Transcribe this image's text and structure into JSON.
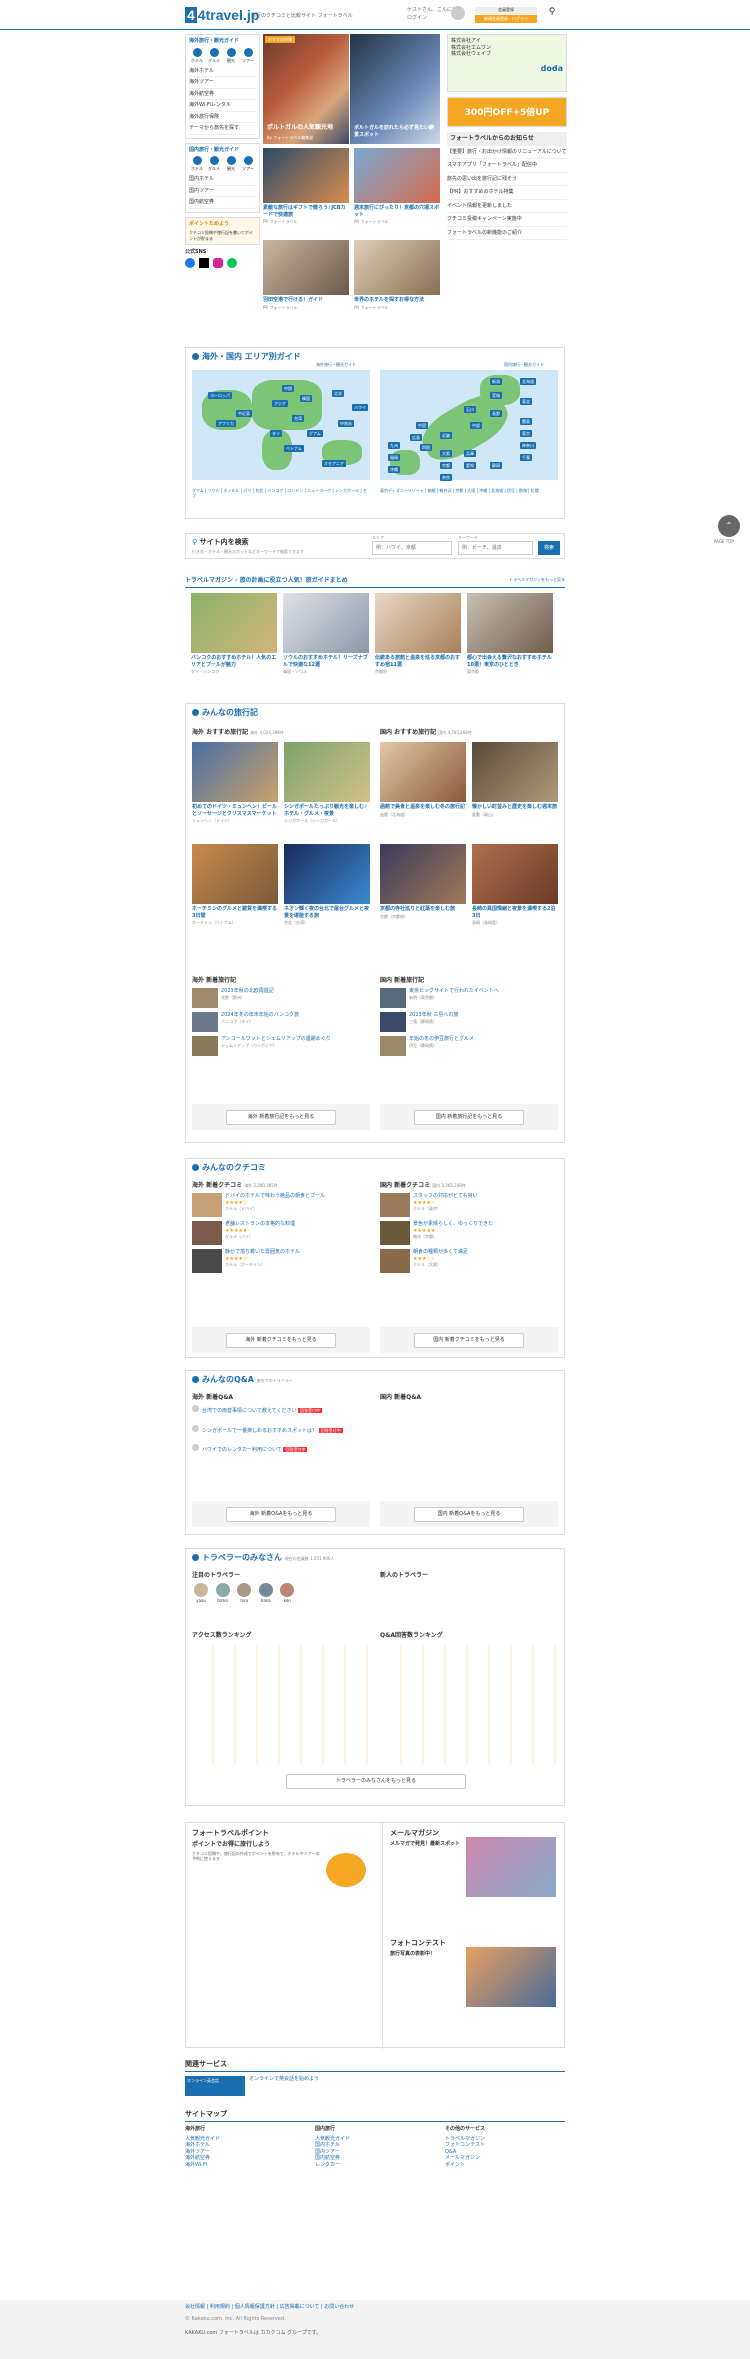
{
  "header": {
    "logo": "4travel.jp",
    "tagline": "旅行のクチコミと比較サイト フォートラベル",
    "greeting": "ゲストさん、こんにちは",
    "login": "ログイン",
    "register": "会員登録",
    "signup_button": "新規会員登録・ログイン",
    "search_label": "検索"
  },
  "left": {
    "overseas_title": "海外旅行・観光ガイド",
    "domestic_title": "国内旅行・観光ガイド",
    "icons": [
      "ホテル",
      "グルメ",
      "観光",
      "ツアー"
    ],
    "overseas_menu": [
      "海外ホテル",
      "海外ツアー",
      "海外航空券",
      "海外Wi-Fiレンタル",
      "海外旅行保険",
      "テーマから旅先を探す"
    ],
    "domestic_menu": [
      "国内ホテル",
      "国内ツアー",
      "国内航空券"
    ],
    "points_title": "ポイントためよう",
    "points_text": "クチコミ投稿や旅行記を書いてポイントが貯まる",
    "follow": "公式SNS"
  },
  "hero": {
    "badge": "おすすめ特集",
    "title": "ポルトガルの人気観光地",
    "caption": "ポルトガルを訪れたら必ず見たい絶景スポット",
    "by": "by フォートラベル編集部"
  },
  "top_cards": [
    {
      "title": "素敵な旅行はギフトで贈ろう♪JCBカードで快適旅",
      "meta": "PR フォートラベル"
    },
    {
      "title": "週末旅行にぴったり！京都の穴場スポット",
      "meta": "PR フォートラベル"
    },
    {
      "title": "羽田空港で行ける！ガイド",
      "meta": "PR フォートラベル"
    },
    {
      "title": "世界のホテルを探すお得な方法",
      "meta": "PR フォートラベル"
    }
  ],
  "right": {
    "ads": [
      "株式会社アイ",
      "株式会社エムワン",
      "株式会社ウェイブ"
    ],
    "brand": "doda",
    "campaign": "300円OFF+5倍UP",
    "notice_title": "フォートラベルからのお知らせ",
    "notices": [
      "【重要】旅行・お出かけ情報のリニューアルについて",
      "スマホアプリ「フォートラベル」配信中",
      "旅先の思い出を旅行記に残そう",
      "【PR】おすすめのホテル特集",
      "イベント情報を更新しました",
      "クチコミ投稿キャンペーン実施中",
      "フォートラベルの新機能のご紹介"
    ]
  },
  "area": {
    "title": "海外・国内 エリア別ガイド",
    "overseas_link": "海外旅行・観光ガイド",
    "domestic_link": "国内旅行・観光ガイド",
    "world": [
      "ヨーロッパ",
      "アジア",
      "北米",
      "中南米",
      "アフリカ",
      "中近東",
      "オセアニア",
      "ハワイ",
      "グアム",
      "台湾",
      "韓国",
      "中国",
      "タイ",
      "ベトナム"
    ],
    "japan": [
      "北海道",
      "東北",
      "関東",
      "中部",
      "近畿",
      "中国",
      "四国",
      "九州",
      "沖縄",
      "東京",
      "大阪",
      "京都",
      "神奈川",
      "千葉",
      "福岡",
      "兵庫",
      "愛知",
      "静岡",
      "長野",
      "石川",
      "広島",
      "宮城",
      "新潟",
      "奈良"
    ],
    "overseas_links": "グアム | ソウル | ホノルル | パリ | 台北 | バンコク | ロンドン | ニューヨーク | シンガポール | セブ",
    "domestic_links": "東京ディズニーリゾート | 箱根 | 軽井沢 | 京都 | 大阪 | 沖縄 | 北海道 | 伊豆 | 熱海 | 札幌"
  },
  "search": {
    "title": "サイト内を検索",
    "hint": "行き先・ホテル・観光スポットなどキーワードで検索できます",
    "area_label": "エリア",
    "keyword_label": "キーワード",
    "area_placeholder": "例：ハワイ、京都",
    "keyword_placeholder": "例：ビーチ、温泉",
    "button": "検索"
  },
  "magazine": {
    "title": "トラベルマガジン - 旅の計画に役立つ人気！旅ガイドまとめ",
    "more": "トラベルマガジンをもっと見る",
    "items": [
      {
        "title": "バンコクのおすすめホテル！人気のエリアとプールが魅力",
        "meta": "タイ・バンコク"
      },
      {
        "title": "ソウルのおすすめホテル！リーズナブルで快適な12選",
        "meta": "韓国・ソウル"
      },
      {
        "title": "伝統ある旅館と温泉を巡る京都のおすすめ宿11選",
        "meta": "京都府"
      },
      {
        "title": "都心で出会える贅沢なおすすめホテル10選！東京のひととき",
        "meta": "東京都"
      }
    ]
  },
  "travelogue": {
    "title": "みんなの旅行記",
    "overseas_head": "海外 おすすめ旅行記",
    "overseas_count": "海外 4,024,398件",
    "domestic_head": "国内 おすすめ旅行記",
    "domestic_count": "国内 4,785,268件",
    "overseas": [
      {
        "title": "初めてのドイツ・ミュンヘン！ビールとソーセージとクリスマスマーケット",
        "meta": "ミュンヘン（ドイツ）"
      },
      {
        "title": "シンガポールたっぷり観光を楽しむ♪ホテル・グルメ・夜景",
        "meta": "シンガポール（シンガポール）"
      },
      {
        "title": "ホーチミンのグルメと雑貨を満喫する3日間",
        "meta": "ホーチミン（ベトナム）"
      },
      {
        "title": "ネオン輝く夜の台北で屋台グルメと夜景を堪能する旅",
        "meta": "台北（台湾）"
      }
    ],
    "domestic": [
      {
        "title": "函館で美食と温泉を楽しむ冬の旅行記",
        "meta": "函館（北海道）"
      },
      {
        "title": "懐かしい町並みと歴史を楽しむ週末旅",
        "meta": "倉敷（岡山）"
      },
      {
        "title": "京都の寺社巡りと紅葉を楽しむ旅",
        "meta": "京都（京都府）"
      },
      {
        "title": "長崎の異国情緒と夜景を満喫する2泊3日",
        "meta": "長崎（長崎県）"
      }
    ],
    "new_overseas_head": "海外 新着旅行記",
    "new_domestic_head": "国内 新着旅行記",
    "new_overseas": [
      {
        "title": "2023年秋の北欧周遊記",
        "meta": "北欧（欧州）"
      },
      {
        "title": "2024年冬の年末年始のバンコク旅",
        "meta": "バンコク（タイ）"
      },
      {
        "title": "アンコールワットとシェムリアップの遺跡めぐり",
        "meta": "シェムリアップ（カンボジア）"
      }
    ],
    "new_domestic": [
      {
        "title": "東京ビッグサイトで行われたイベントへ",
        "meta": "有明（東京都）"
      },
      {
        "title": "2023年秋 三島への旅",
        "meta": "三島（静岡県）"
      },
      {
        "title": "年始の冬の伊豆旅行とグルメ",
        "meta": "伊豆（静岡県）"
      }
    ],
    "more_overseas": "海外 新着旅行記をもっと見る",
    "more_domestic": "国内 新着旅行記をもっと見る"
  },
  "reviews": {
    "title": "みんなのクチコミ",
    "overseas_head": "海外 新着クチコミ",
    "overseas_count": "海外 2,280,365件",
    "domestic_head": "国内 新着クチコミ",
    "domestic_count": "国内 3,265,209件",
    "overseas": [
      {
        "title": "ドバイのホテルで味わう絶品の朝食とプール",
        "meta": "ホテル（ドバイ）"
      },
      {
        "title": "老舗レストランの本格的な料理",
        "meta": "グルメ（パリ）"
      },
      {
        "title": "静かで落ち着いた雰囲気のホテル",
        "meta": "ホテル（ホーチミン）"
      }
    ],
    "domestic": [
      {
        "title": "スタッフの対応がとても良い",
        "meta": "ホテル（東京）"
      },
      {
        "title": "景色が素晴らしく、ゆっくりできた",
        "meta": "観光（京都）"
      },
      {
        "title": "朝食の種類が多くて満足",
        "meta": "ホテル（大阪）"
      }
    ],
    "more_overseas": "海外 新着クチコミをもっと見る",
    "more_domestic": "国内 新着クチコミをもっと見る"
  },
  "qa": {
    "title": "みんなのQ&A",
    "subtitle": "旅先でのトラベラー",
    "overseas_head": "海外 新着Q&A",
    "domestic_head": "国内 新着Q&A",
    "overseas": [
      {
        "q": "台湾での両替事情について教えてください",
        "badge": "回答受付中"
      },
      {
        "q": "シンガポールで一番楽しめるおすすめスポットは？",
        "badge": "回答受付中"
      },
      {
        "q": "ハワイでのレンタカー利用について",
        "badge": "回答受付中"
      }
    ],
    "more_overseas": "海外 新着Q&Aをもっと見る",
    "more_domestic": "国内 新着Q&Aをもっと見る"
  },
  "travelers": {
    "title": "トラベラーのみなさん",
    "count": "現在の会員数 1,051,906人",
    "featured_head": "注目のトラベラー",
    "new_head": "新人のトラベラー",
    "access_head": "アクセス数ランキング",
    "qa_head": "Q&A回答数ランキング",
    "featured": [
      "yasu",
      "tomo",
      "hiro",
      "hana",
      "ken"
    ],
    "more": "トラベラーのみなさんをもっと見る"
  },
  "bottom": {
    "points_title": "フォートラベルポイント",
    "points_sub": "ポイントでお得に旅行しよう",
    "points_text": "クチコミ投稿や、旅行記の作成でポイントを貯めて、ホテルやツアーの予約に使えます",
    "mail_title": "メールマガジン",
    "mail_sub": "メルマガで発見！最新スポット",
    "photo_title": "フォトコンテスト",
    "photo_sub": "旅行写真の表彰中！"
  },
  "related": {
    "title": "関連サービス",
    "item": "オンライン英会話",
    "text": "オンラインで英会話を始めよう"
  },
  "sitemap": {
    "title": "サイトマップ",
    "cols": [
      {
        "head": "海外旅行",
        "items": [
          "人気観光ガイド",
          "海外ホテル",
          "海外ツアー",
          "海外航空券",
          "海外Wi-Fi"
        ]
      },
      {
        "head": "国内旅行",
        "items": [
          "人気観光ガイド",
          "国内ホテル",
          "国内ツアー",
          "国内航空券",
          "レンタカー"
        ]
      },
      {
        "head": "その他のサービス",
        "items": [
          "トラベルマガジン",
          "フォトコンテスト",
          "Q&A",
          "メールマガジン",
          "ポイント"
        ]
      }
    ]
  },
  "footer": {
    "line1": "会社情報 | 利用規約 | 個人情報保護方針 | 広告掲載について | お問い合わせ",
    "copyright": "© Kakaku.com, Inc. All Rights Reserved.",
    "group": "KAKAKU.com フォートラベルは カカクコム グループです。"
  },
  "pagetop": "PAGE TOP"
}
